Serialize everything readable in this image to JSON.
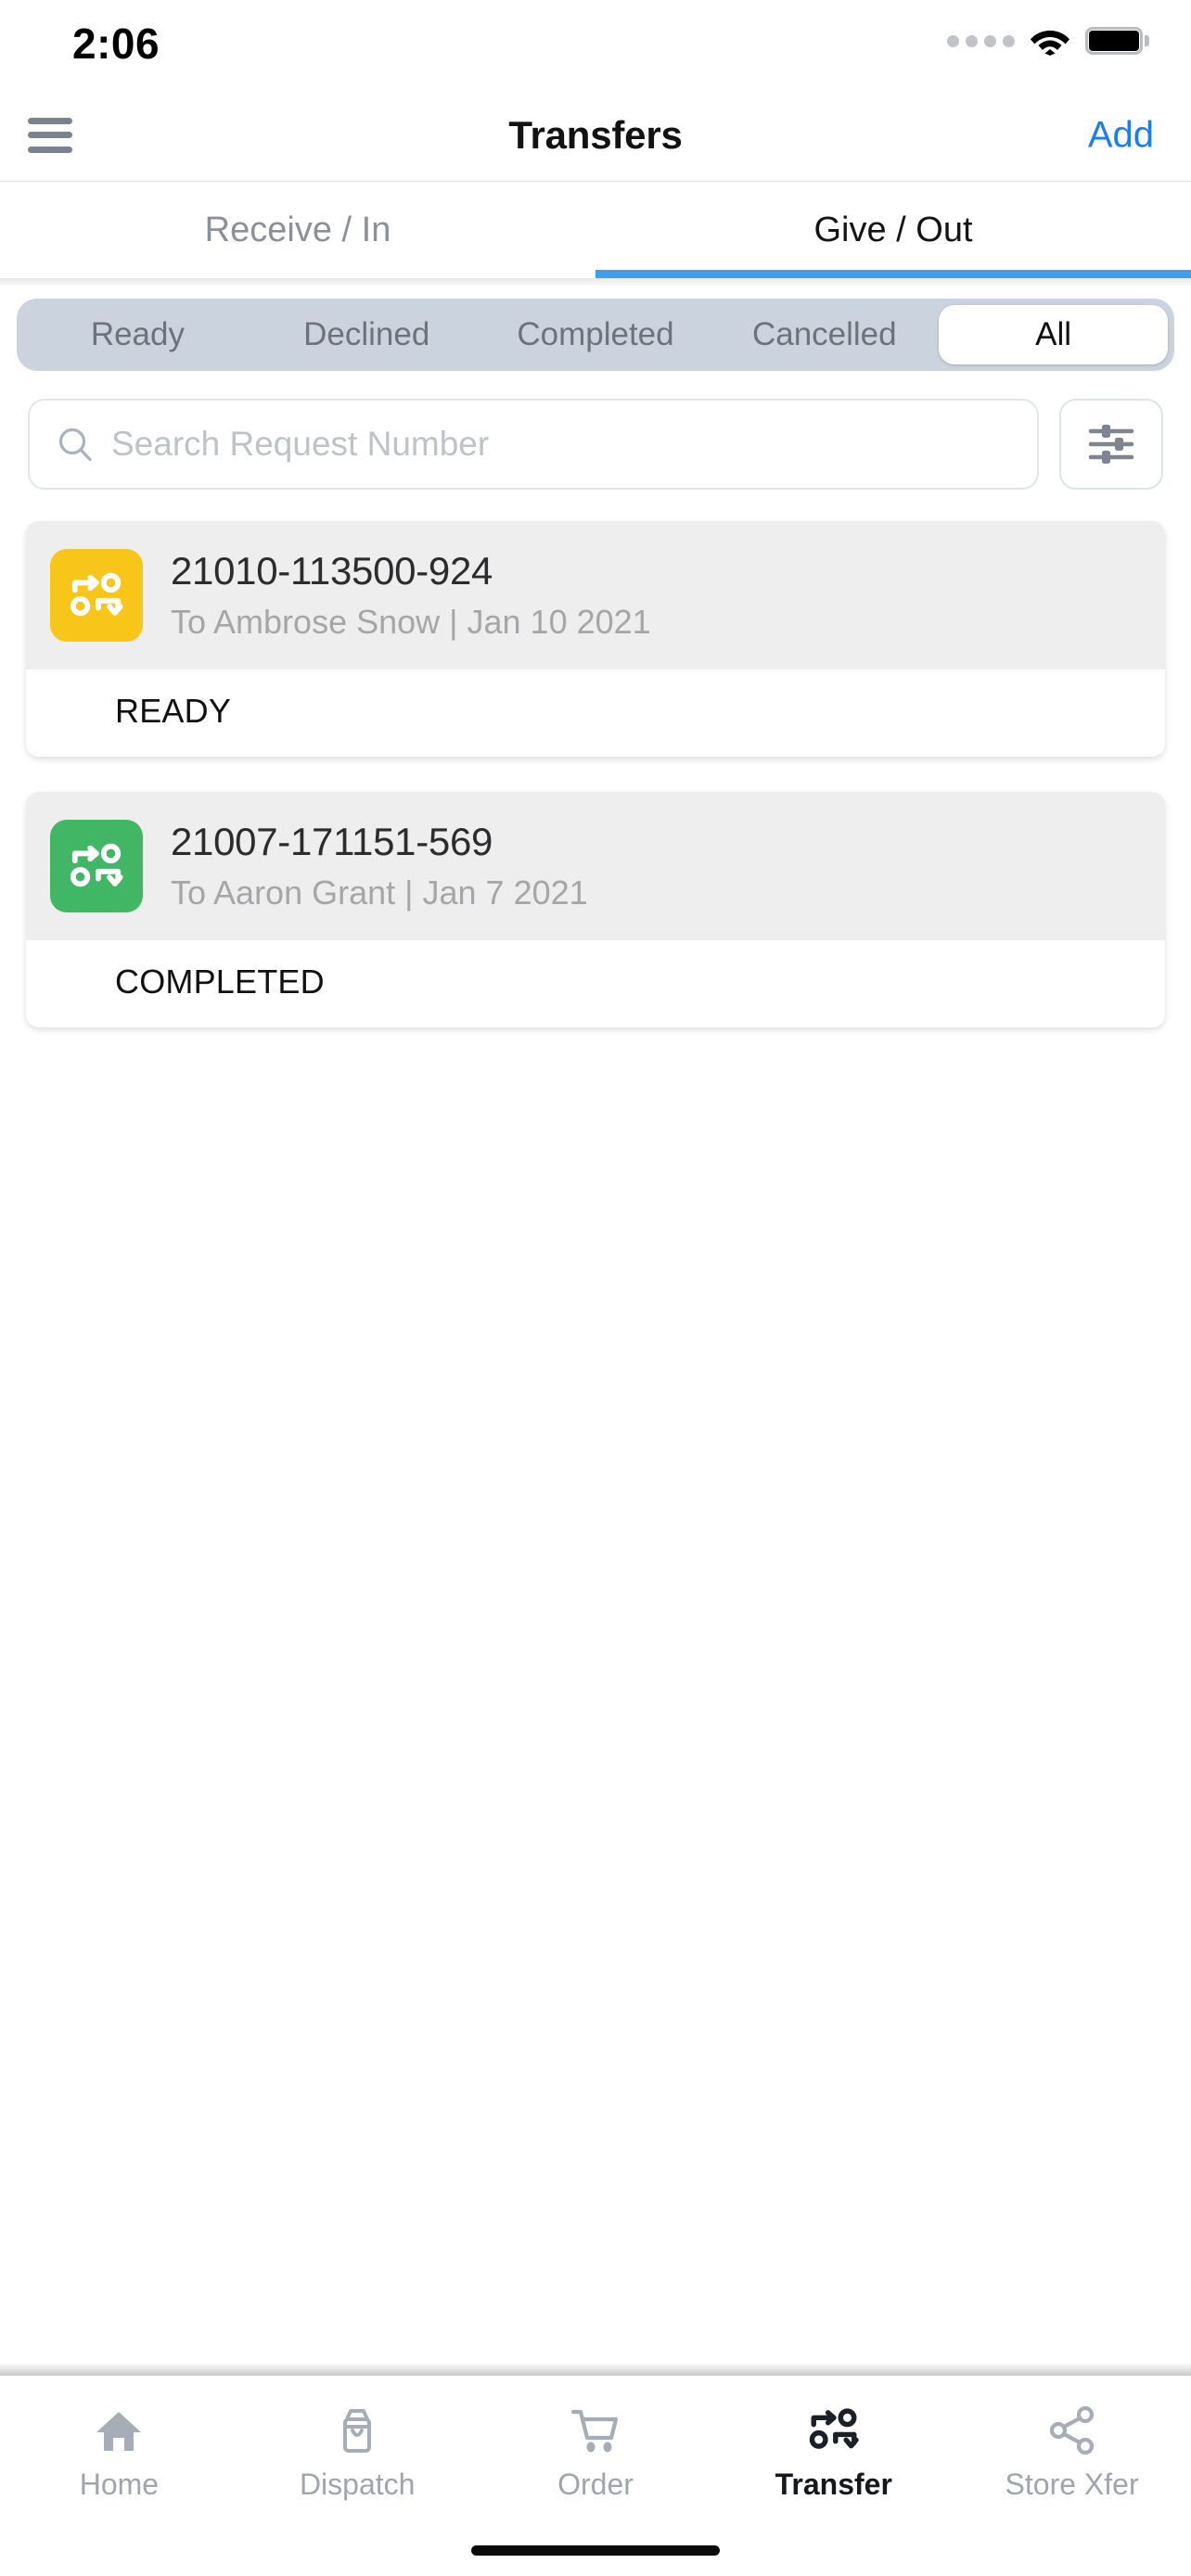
{
  "status_bar": {
    "time": "2:06",
    "cellular_icon": "signal-dots-icon",
    "wifi_icon": "wifi-icon",
    "battery_icon": "battery-full-icon"
  },
  "header": {
    "menu_icon": "hamburger-menu-icon",
    "title": "Transfers",
    "add_label": "Add"
  },
  "tabs": [
    {
      "label": "Receive / In",
      "active": false
    },
    {
      "label": "Give / Out",
      "active": true
    }
  ],
  "filters": {
    "options": [
      {
        "label": "Ready",
        "active": false
      },
      {
        "label": "Declined",
        "active": false
      },
      {
        "label": "Completed",
        "active": false
      },
      {
        "label": "Cancelled",
        "active": false
      },
      {
        "label": "All",
        "active": true
      }
    ]
  },
  "search": {
    "icon": "search-icon",
    "placeholder": "Search Request Number",
    "value": "",
    "filter_button_icon": "sliders-filter-icon"
  },
  "transfers": [
    {
      "icon": "transfer-shuffle-icon",
      "icon_color": "#F8C519",
      "request_number": "21010-113500-924",
      "subtitle": "To Ambrose Snow | Jan 10 2021",
      "status": "READY"
    },
    {
      "icon": "transfer-shuffle-icon",
      "icon_color": "#41B665",
      "request_number": "21007-171151-569",
      "subtitle": "To Aaron Grant | Jan 7 2021",
      "status": "COMPLETED"
    }
  ],
  "bottom_nav": [
    {
      "label": "Home",
      "icon": "home-icon",
      "active": false
    },
    {
      "label": "Dispatch",
      "icon": "dispatch-bag-icon",
      "active": false
    },
    {
      "label": "Order",
      "icon": "shopping-cart-icon",
      "active": false
    },
    {
      "label": "Transfer",
      "icon": "transfer-shuffle-icon",
      "active": true
    },
    {
      "label": "Store Xfer",
      "icon": "share-nodes-icon",
      "active": false
    }
  ],
  "colors": {
    "accent_blue": "#409FE8",
    "link_blue": "#1A7CF7",
    "segment_bg": "#CBD4DE",
    "card_bg": "#EEEEEE"
  }
}
